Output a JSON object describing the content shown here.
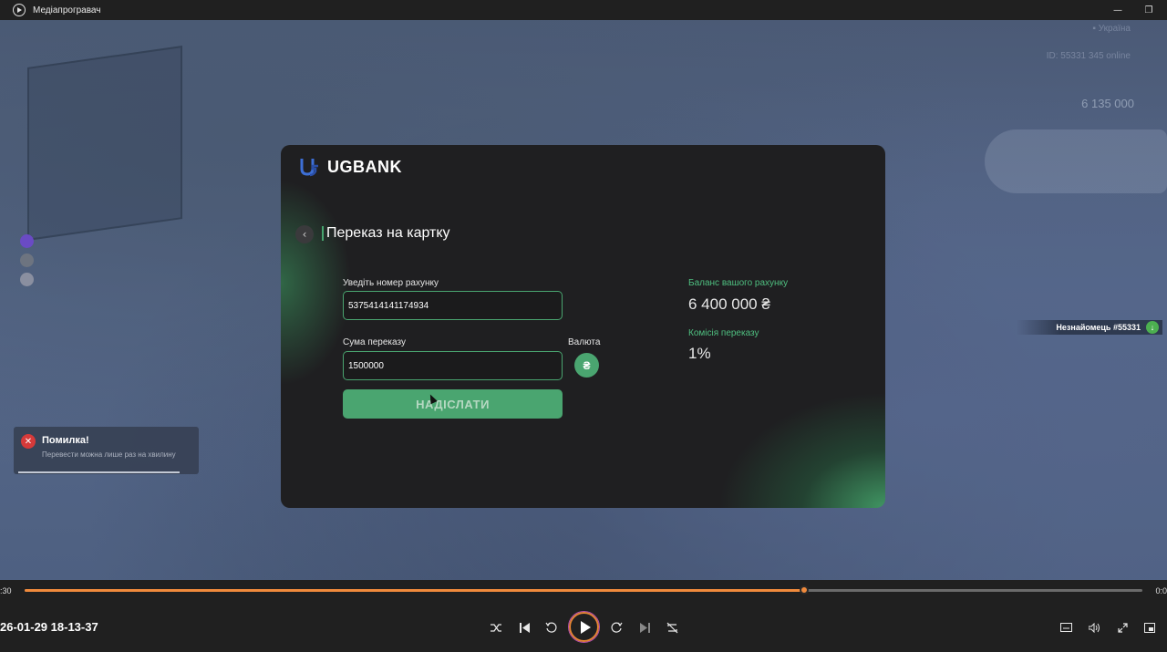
{
  "window": {
    "title": "Медіапрогравач",
    "minimize_glyph": "—",
    "restore_glyph": "❐"
  },
  "game_hud": {
    "top_line": "▪ Україна",
    "server_line": "ID: 55331    345 online",
    "money": "6 135 000",
    "player_tag": "Незнайомець #55331",
    "player_icon_glyph": "↓"
  },
  "toast": {
    "title": "Помилка!",
    "message": "Перевести можна лише раз на хвилину",
    "icon": "close-icon",
    "icon_glyph": "✕"
  },
  "bank": {
    "logo_text": "UGBANK",
    "back_glyph": "‹",
    "page_title": "Переказ на картку",
    "account_label": "Уведіть номер рахунку",
    "account_value": "5375414141174934",
    "amount_label": "Сума переказу",
    "amount_value": "1500000",
    "currency_label": "Валюта",
    "currency_glyph": "₴",
    "send_label": "НАДІСЛАТИ",
    "balance_label": "Баланс вашого рахунку",
    "balance_value": "6 400 000 ₴",
    "fee_label": "Комісія переказу",
    "fee_value": "1%"
  },
  "player": {
    "time_elapsed": ":30",
    "time_total": "0:0",
    "progress": 0.697,
    "file_name": "26-01-29 18-13-37",
    "accent": "#f08a3c"
  },
  "colors": {
    "brand_green": "#4aa570",
    "label_green": "#4fbf80",
    "error_red": "#d63a3a"
  }
}
